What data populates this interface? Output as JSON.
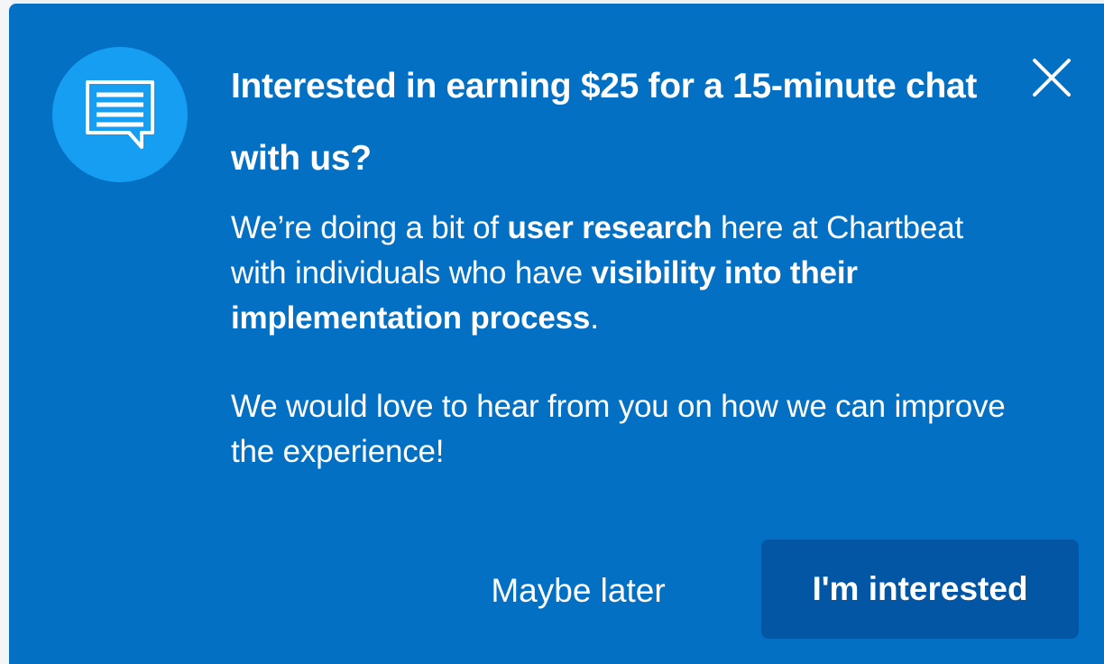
{
  "dialog": {
    "title": "Interested in earning $25 for a 15-minute chat with us?",
    "paragraph1": {
      "t1": "We’re doing a bit of ",
      "b1": "user research",
      "t2": " here at Chartbeat with individuals who have ",
      "b2": "visibility into their implementation process",
      "t3": "."
    },
    "paragraph2": "We would love to hear from you on how we can improve the experience!",
    "icons": {
      "badge": "chat-bubble-icon",
      "close": "close-icon"
    }
  },
  "actions": {
    "maybe_later_label": "Maybe later",
    "interested_label": "I'm interested"
  },
  "colors": {
    "panel": "#0470c4",
    "badge": "#169ef3",
    "primary_button": "#0256a4",
    "text": "#ffffff"
  }
}
